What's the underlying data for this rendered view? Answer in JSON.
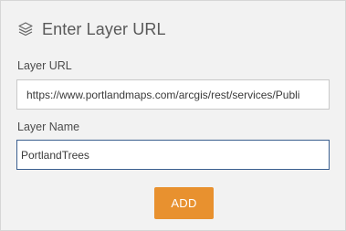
{
  "header": {
    "icon": "layers-icon",
    "title": "Enter Layer URL"
  },
  "form": {
    "url_label": "Layer URL",
    "url_value": "https://www.portlandmaps.com/arcgis/rest/services/Publi",
    "name_label": "Layer Name",
    "name_value": "PortlandTrees",
    "add_label": "ADD"
  },
  "colors": {
    "panel_background": "#f2f2f2",
    "accent_button": "#e8912f",
    "focused_border": "#3b5f8f"
  }
}
